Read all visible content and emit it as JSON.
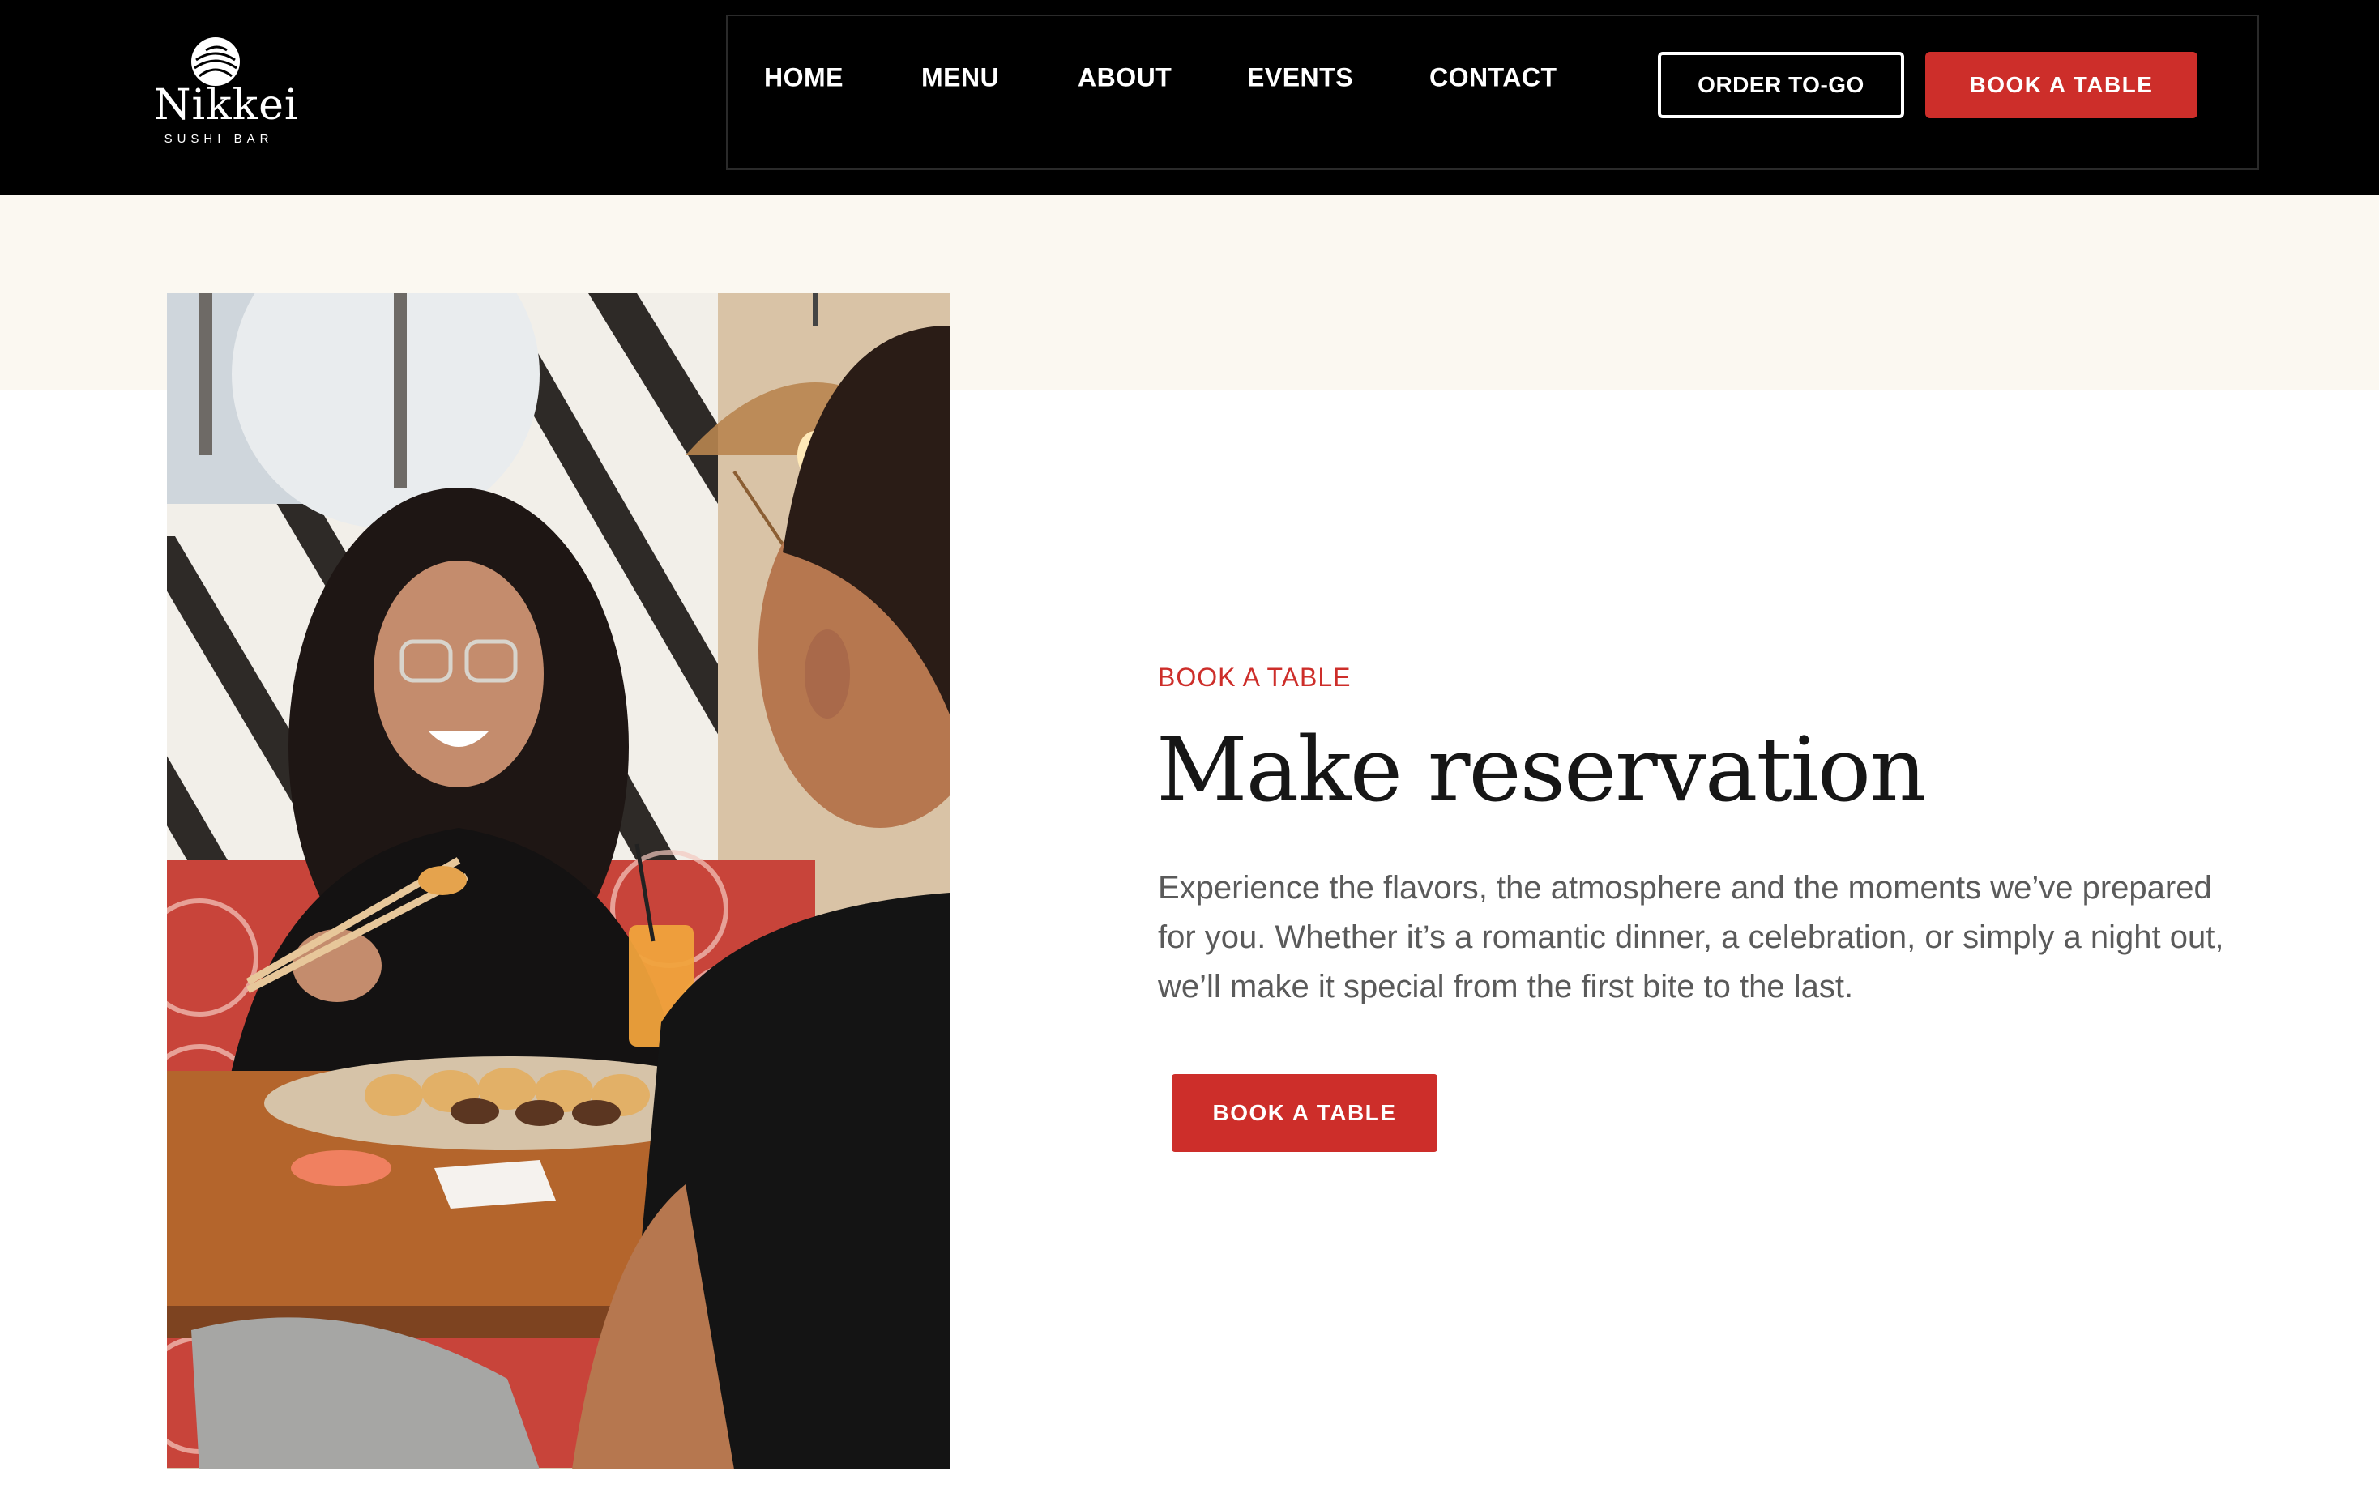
{
  "brand": {
    "name": "Nikkei",
    "tagline": "SUSHI BAR"
  },
  "nav": {
    "items": [
      {
        "label": "HOME"
      },
      {
        "label": "MENU"
      },
      {
        "label": "ABOUT"
      },
      {
        "label": "EVENTS"
      },
      {
        "label": "CONTACT"
      }
    ],
    "order_label": "ORDER TO-GO",
    "book_label": "BOOK A TABLE"
  },
  "reservation": {
    "eyebrow": "BOOK A TABLE",
    "title": "Make reservation",
    "description": "Experience the flavors, the atmosphere and the moments we’ve prepared for you. Whether it’s a romantic dinner, a celebration, or simply a night out, we’ll make it special from the first bite to the last.",
    "cta_label": "BOOK A TABLE"
  },
  "colors": {
    "accent": "#cd2e2a",
    "header_bg": "#000000",
    "cream": "#fbf8f1"
  }
}
